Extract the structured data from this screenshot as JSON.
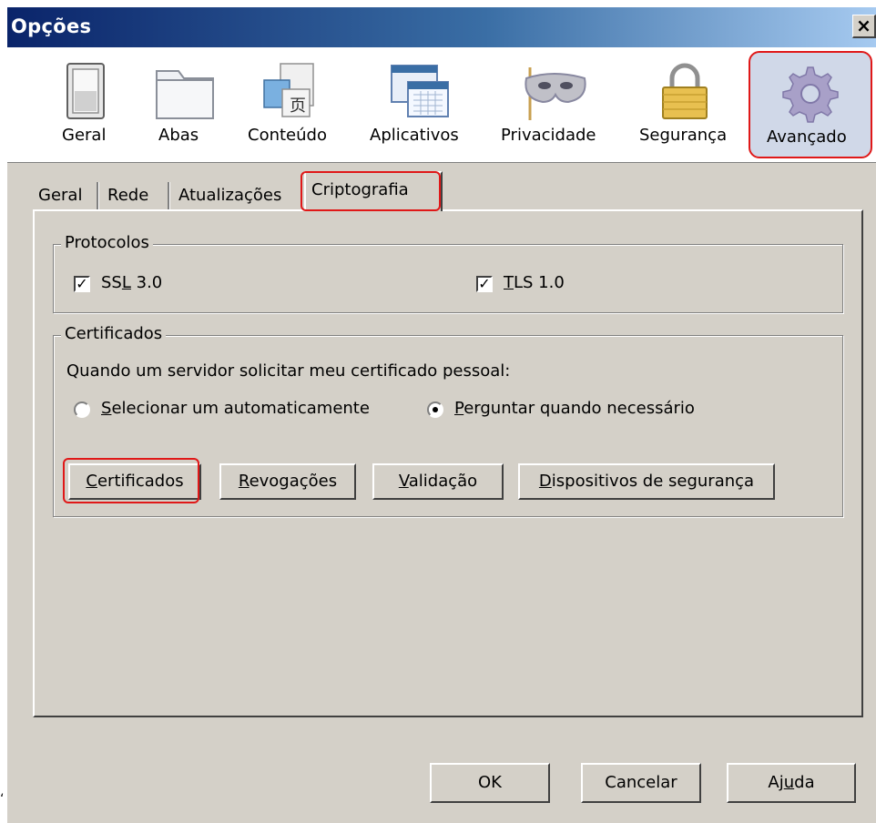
{
  "window": {
    "title": "Opções",
    "close_label": "×"
  },
  "toolbar": {
    "items": [
      {
        "label": "Geral",
        "icon": "switch-icon"
      },
      {
        "label": "Abas",
        "icon": "folder-tabs-icon"
      },
      {
        "label": "Conteúdo",
        "icon": "document-content-icon"
      },
      {
        "label": "Aplicativos",
        "icon": "application-window-icon"
      },
      {
        "label": "Privacidade",
        "icon": "mask-icon"
      },
      {
        "label": "Segurança",
        "icon": "padlock-icon"
      },
      {
        "label": "Avançado",
        "icon": "gear-icon",
        "selected": true
      }
    ]
  },
  "tabs": [
    {
      "label": "Geral"
    },
    {
      "label": "Rede"
    },
    {
      "label": "Atualizações"
    },
    {
      "label": "Criptografia",
      "active": true
    }
  ],
  "protocols": {
    "legend": "Protocolos",
    "ssl": {
      "label_pre": "SS",
      "label_u": "L",
      "label_post": " 3.0",
      "checked": true,
      "check_mark": "✓"
    },
    "tls": {
      "label_pre": "",
      "label_u": "T",
      "label_post": "LS 1.0",
      "checked": true,
      "check_mark": "✓"
    }
  },
  "certificates": {
    "legend": "Certificados",
    "prompt": "Quando um servidor solicitar meu certificado pessoal:",
    "radio_auto": {
      "label_u": "S",
      "label_post": "elecionar um automaticamente",
      "selected": false
    },
    "radio_ask": {
      "label_u": "P",
      "label_post": "erguntar quando necessário",
      "selected": true
    },
    "buttons": {
      "certificados": {
        "label_u": "C",
        "label_post": "ertificados"
      },
      "revogacoes": {
        "label_u": "R",
        "label_post": "evogações"
      },
      "validacao": {
        "label_u": "V",
        "label_post": "alidação"
      },
      "dispositivos": {
        "label_u": "D",
        "label_post": "ispositivos de segurança"
      }
    }
  },
  "footer": {
    "ok": "OK",
    "cancel": "Cancelar",
    "help_pre": "Aj",
    "help_u": "u",
    "help_post": "da"
  },
  "stray_mark": "‘",
  "colors": {
    "titlebar_start": "#0a246a",
    "titlebar_end": "#a6caf0",
    "highlight": "#e01818",
    "face": "#d4d0c8"
  }
}
